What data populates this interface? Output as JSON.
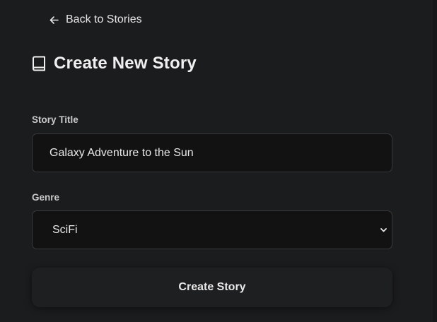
{
  "nav": {
    "back_label": "Back to Stories",
    "back_icon": "arrow-left-icon"
  },
  "header": {
    "title": "Create New Story",
    "icon": "book-icon"
  },
  "form": {
    "title_label": "Story Title",
    "title_value": "Galaxy Adventure to the Sun",
    "genre_label": "Genre",
    "genre_value": "SciFi",
    "genre_icon": "chevron-down-icon",
    "submit_label": "Create Story"
  },
  "colors": {
    "background": "#1b1c1e",
    "field_background": "#121213",
    "field_border": "#37383b",
    "text": "#e8e8e8"
  }
}
